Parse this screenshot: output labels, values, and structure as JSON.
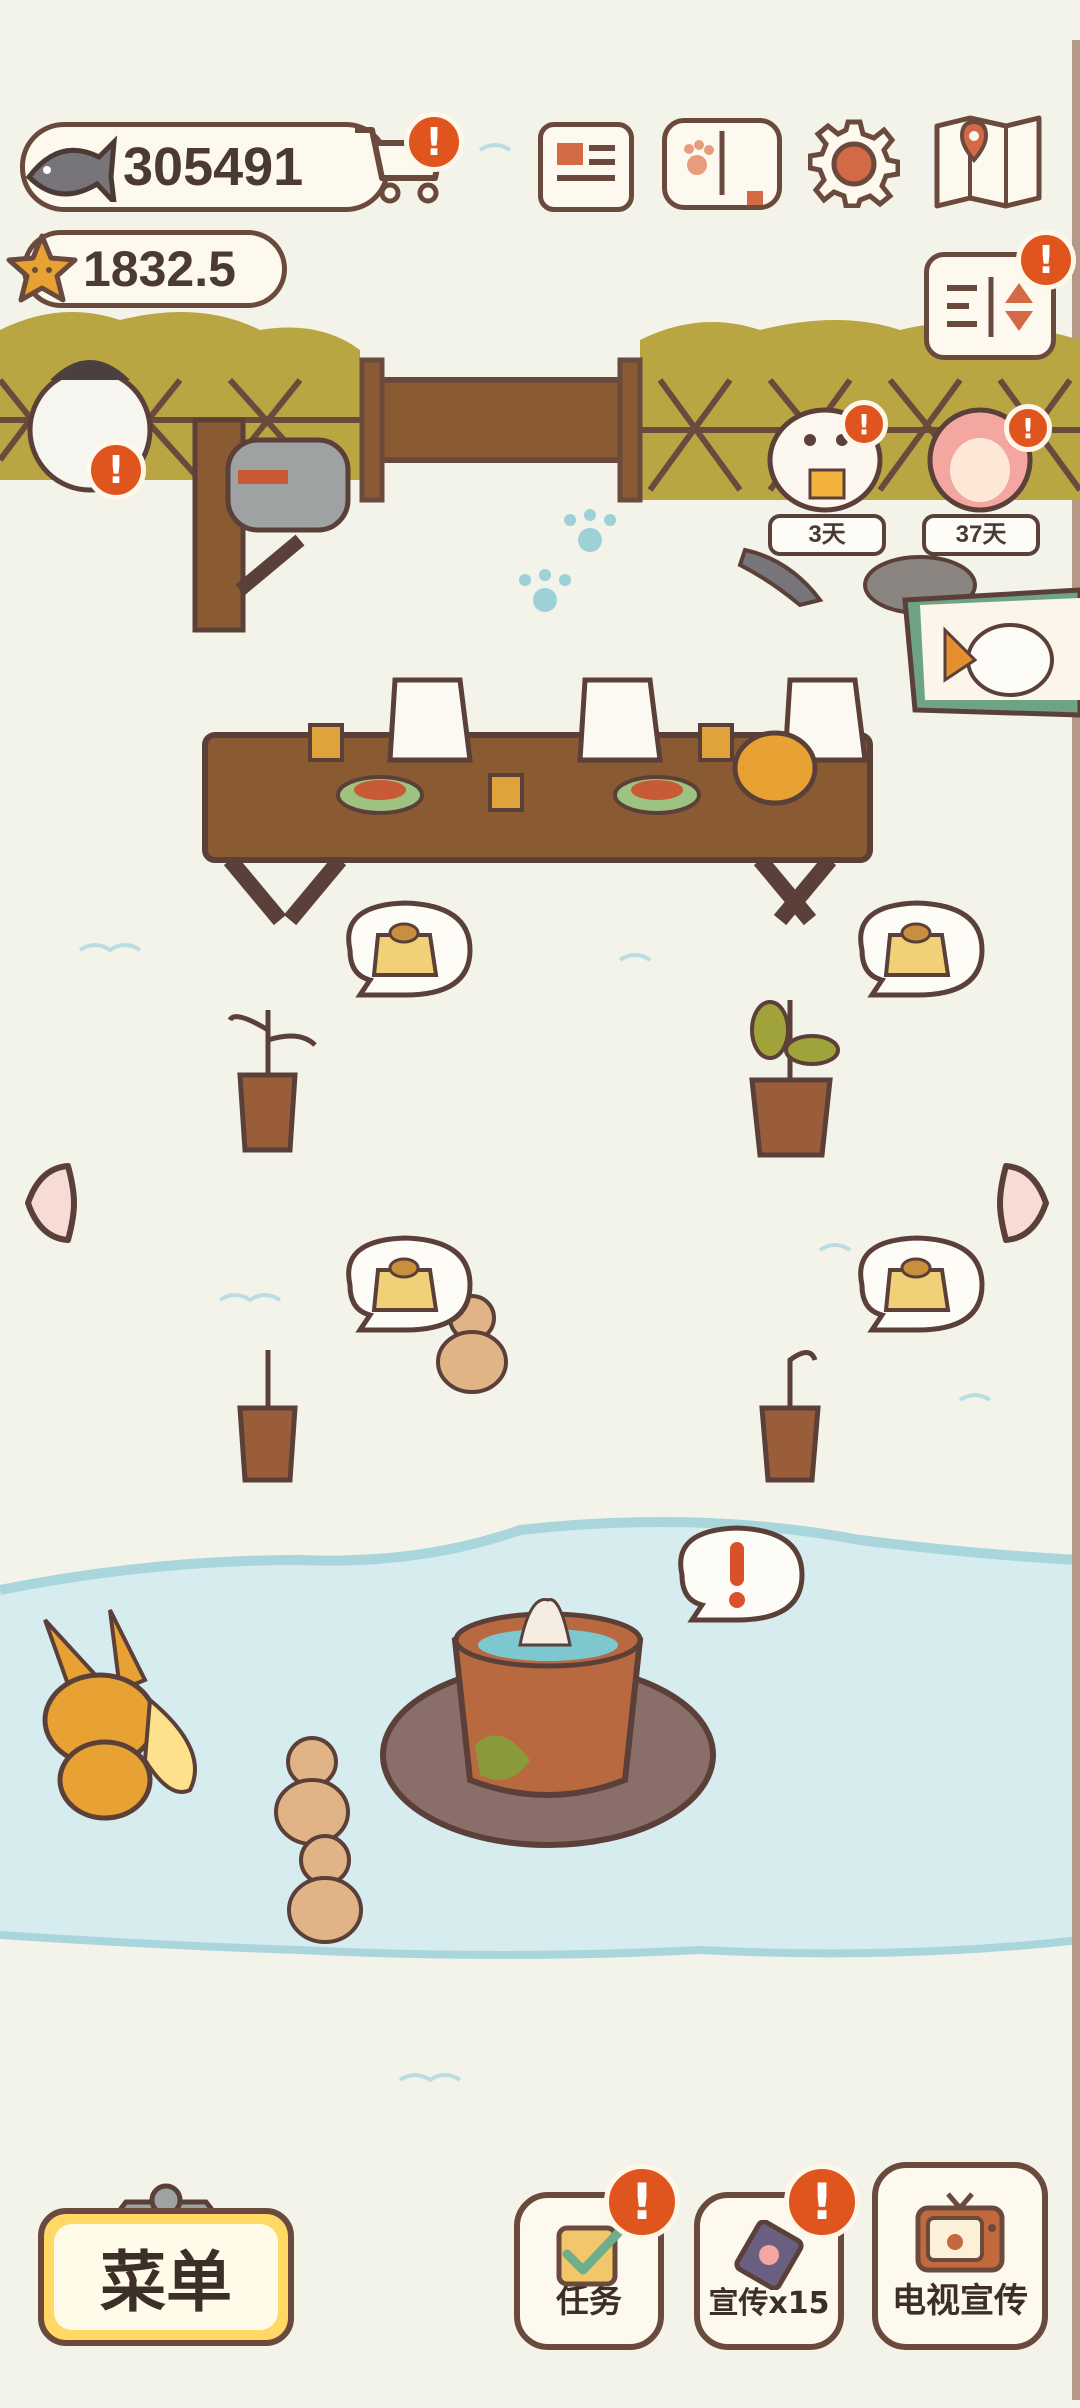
{
  "currency": {
    "fish": {
      "value": "305491",
      "icon": "fish-icon"
    },
    "star": {
      "value": "1832.5",
      "icon": "star-icon"
    }
  },
  "top_icons": [
    "cart-icon",
    "newspaper-icon",
    "paw-book-icon",
    "gear-icon",
    "map-icon"
  ],
  "visitors": [
    {
      "duration": "3天"
    },
    {
      "duration": "37天"
    }
  ],
  "thought_bubbles": [
    "bread-bag-icon",
    "bread-bag-icon",
    "bread-bag-icon",
    "bread-bag-icon",
    "exclamation-icon"
  ],
  "bottom_bar": {
    "menu_label": "菜单",
    "tasks_label": "任务",
    "promo_label": "宣传x15",
    "tv_label": "电视宣传"
  },
  "colors": {
    "background": "#f3f3ea",
    "outline": "#6b4a3e",
    "badge": "#e0541e",
    "menu_button": "#ffd866",
    "water": "#d6ecef",
    "wood": "#8a5a33"
  }
}
